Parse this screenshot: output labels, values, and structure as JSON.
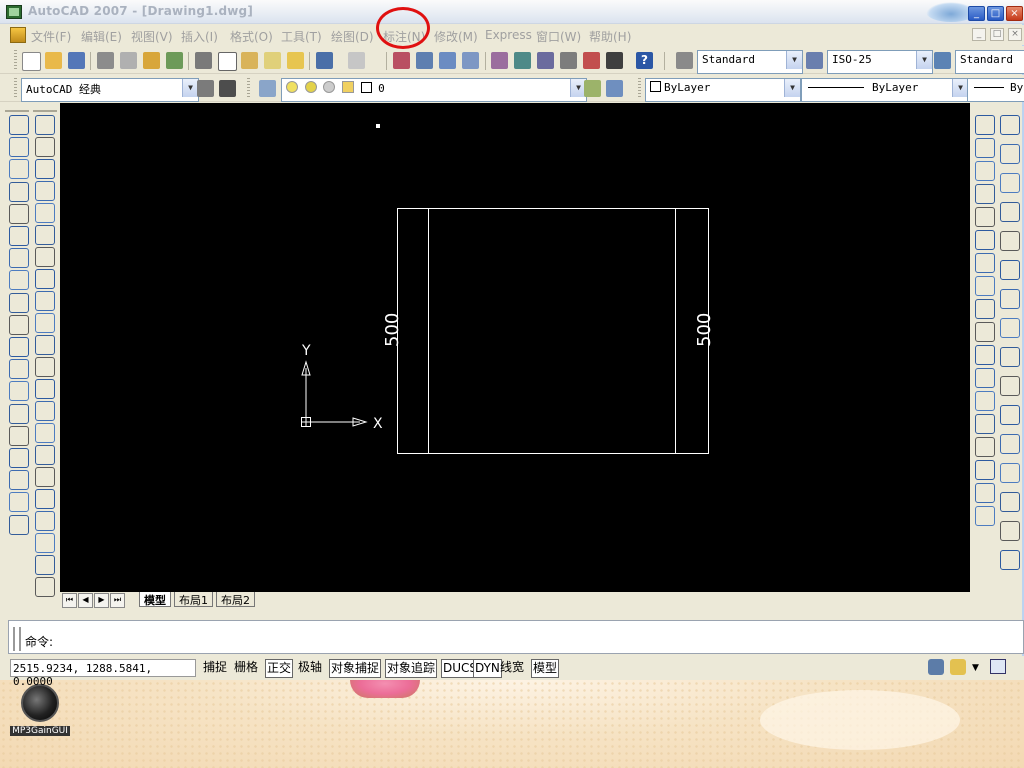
{
  "window": {
    "title": "AutoCAD 2007 - [Drawing1.dwg]",
    "caption_buttons": [
      "_",
      "□",
      "×"
    ],
    "mdi_buttons": [
      "_",
      "□",
      "×"
    ]
  },
  "menu": {
    "items": [
      "文件(F)",
      "编辑(E)",
      "视图(V)",
      "插入(I)",
      "格式(O)",
      "工具(T)",
      "绘图(D)",
      "标注(N)",
      "修改(M)",
      "Express",
      "窗口(W)",
      "帮助(H)"
    ]
  },
  "toolbar_styles": {
    "text_style": "Standard",
    "dim_style": "ISO-25",
    "table_style": "Standard"
  },
  "toolbar_layers": {
    "workspace": "AutoCAD 经典",
    "layer": "0",
    "color": "ByLayer",
    "linetype": "ByLayer",
    "lineweight": "By"
  },
  "canvas": {
    "dim_left": "500",
    "dim_right": "500",
    "ucs_x": "X",
    "ucs_y": "Y"
  },
  "tabs": [
    "模型",
    "布局1",
    "布局2"
  ],
  "command": {
    "prompt": "命令:"
  },
  "status": {
    "coords": "2515.9234, 1288.5841, 0.0000",
    "buttons": [
      "捕捉",
      "栅格",
      "正交",
      "极轴",
      "对象捕捉",
      "对象追踪",
      "DUCS",
      "DYN",
      "线宽",
      "模型"
    ],
    "on_flags": [
      false,
      false,
      true,
      false,
      true,
      true,
      true,
      true,
      false,
      true
    ]
  },
  "desktop": {
    "icon_label": "MP3GainGUI"
  },
  "annotation_color": "#e01010",
  "canvas_color": "#000000"
}
